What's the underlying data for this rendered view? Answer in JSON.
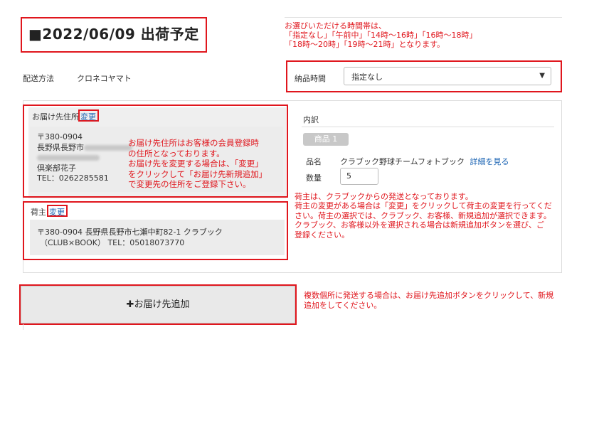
{
  "header": {
    "title": "■2022/06/09 出荷予定",
    "time_note": [
      "お選びいただける時間帯は、",
      "「指定なし」「午前中」「14時～16時」「16時～18時」",
      "「18時～20時」「19時～21時」となります。"
    ]
  },
  "shipping": {
    "method_label": "配送方法",
    "method_value": "クロネコヤマト",
    "time_label": "納品時間",
    "time_selected": "指定なし",
    "chevron_icon": "chevron-down-icon"
  },
  "recipient": {
    "heading": "お届け先住所",
    "change_link": "変更",
    "postal": "〒380-0904",
    "pref_prefix": "長野県長野市",
    "name": "倶楽部花子",
    "tel": "TEL：0262285581",
    "note": [
      "お届け先住所はお客様の会員登録時",
      "の住所となっております。",
      "お届け先を変更する場合は、「変更」",
      "をクリックして「お届け先新規追加」",
      "で変更先の住所をご登録下さい。"
    ]
  },
  "shipper": {
    "heading": "荷主",
    "change_link": "変更",
    "address_line1": "〒380-0904 長野県長野市七瀬中町82-1 クラブック",
    "address_line2": "（CLUB×BOOK） TEL：05018073770",
    "note": [
      "荷主は、クラブックからの発送となっております。",
      "荷主の変更がある場合は「変更」をクリックして荷主の変更を行ってくだ",
      "さい。荷主の選択では、クラブック、お客様、新規追加が選択できます。",
      "クラブック、お客様以外を選択される場合は新規追加ボタンを選び、ご",
      "登録ください。"
    ]
  },
  "breakdown": {
    "heading": "内訳",
    "product_badge": "商品 1",
    "name_label": "品名",
    "name_value": "クラブック野球チームフォトブック",
    "detail_link": "詳細を見る",
    "qty_label": "数量",
    "qty_value": "5"
  },
  "add_destination": {
    "button_label": "✚お届け先追加",
    "note": [
      "複数個所に発送する場合は、お届け先追加ボタンをクリックして、新規",
      "追加をしてください。"
    ]
  },
  "colors": {
    "annotation": "#e0161d",
    "link": "#1a63b3",
    "panel_gray": "#efefef"
  }
}
